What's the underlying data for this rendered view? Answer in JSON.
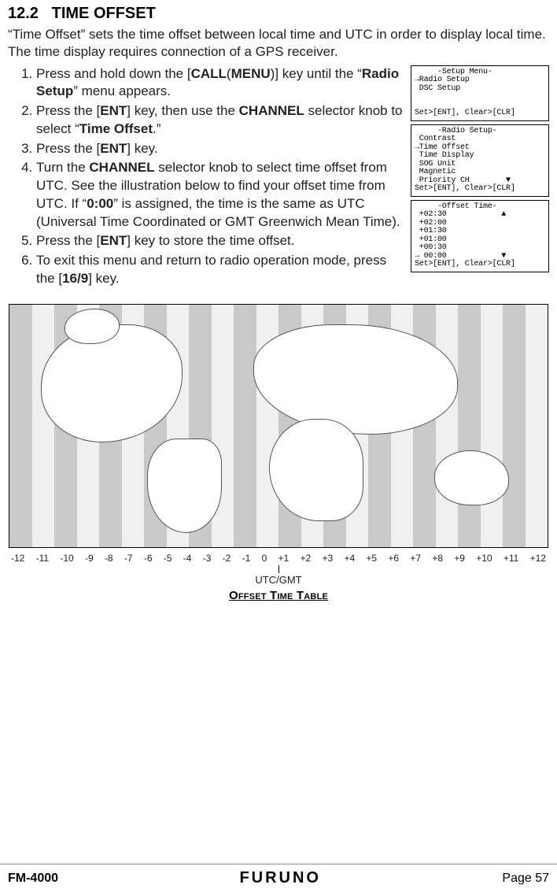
{
  "section": {
    "number": "12.2",
    "title": "TIME OFFSET"
  },
  "intro": "“Time Offset” sets the time offset between local time and UTC in order to display local time. The time display requires connection of a GPS receiver.",
  "steps": {
    "s1a": "Press and hold down the [",
    "s1_call": "CALL",
    "s1_paren_open": "(",
    "s1_menu": "MENU",
    "s1_paren_close": ")",
    "s1b": "] key until the “",
    "s1_radio_setup": "Radio Setup",
    "s1c": "” menu appears.",
    "s2a": "Press the [",
    "s2_ent": "ENT",
    "s2b": "] key, then use the ",
    "s2_channel": "CHANNEL",
    "s2c": " selector knob to select “",
    "s2_time_offset": "Time Offset",
    "s2d": ".”",
    "s3a": "Press the [",
    "s3_ent": "ENT",
    "s3b": "] key.",
    "s4a": "Turn the ",
    "s4_channel": "CHANNEL",
    "s4b": " selector knob to select time offset from UTC. See the illustration below to find your offset time from UTC. If “",
    "s4_zero": "0:00",
    "s4c": "” is assigned, the time is the same as UTC (Universal Time Coordinated or GMT Greenwich Mean Time).",
    "s5a": "Press the [",
    "s5_ent": "ENT",
    "s5b": "] key to store the time offset.",
    "s6a": "To exit this menu and return to radio operation mode, press the [",
    "s6_169": "16/9",
    "s6b": "] key."
  },
  "lcd": {
    "screen1": "     -Setup Menu-\n→Radio Setup\n DSC Setup\n\n\nSet>[ENT], Clear>[CLR]",
    "screen2": "     -Radio Setup-\n Contrast\n→Time Offset\n Time Display\n SOG Unit\n Magnetic\n Priority CH        ▼\nSet>[ENT], Clear>[CLR]",
    "screen3": "     -Offset Time-\n +02:30            ▲\n +02:00\n +01:30\n +01:00\n +00:30\n→ 00:00            ▼\nSet>[ENT], Clear>[CLR]"
  },
  "axis": [
    "-12",
    "-11",
    "-10",
    "-9",
    "-8",
    "-7",
    "-6",
    "-5",
    "-4",
    "-3",
    "-2",
    "-1",
    "0",
    "+1",
    "+2",
    "+3",
    "+4",
    "+5",
    "+6",
    "+7",
    "+8",
    "+9",
    "+10",
    "+11",
    "+12"
  ],
  "utc_label": "UTC/GMT",
  "caption": "Offset Time Table",
  "footer": {
    "left": "FM-4000",
    "brand": "FURUNO",
    "right": "Page 57"
  }
}
